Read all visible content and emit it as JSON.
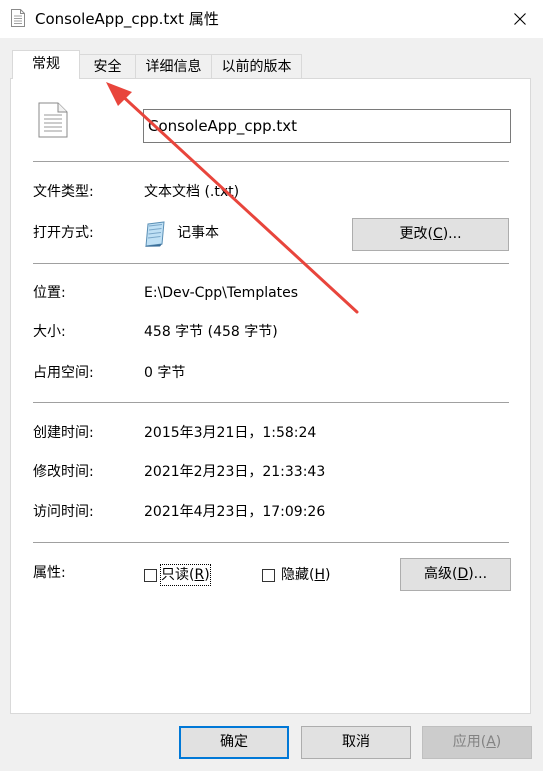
{
  "window": {
    "title": "ConsoleApp_cpp.txt 属性"
  },
  "tabs": [
    {
      "label": "常规",
      "active": true
    },
    {
      "label": "安全",
      "active": false
    },
    {
      "label": "详细信息",
      "active": false
    },
    {
      "label": "以前的版本",
      "active": false
    }
  ],
  "general": {
    "filename": "ConsoleApp_cpp.txt",
    "file_type_label": "文件类型:",
    "file_type_value": "文本文档 (.txt)",
    "open_with_label": "打开方式:",
    "open_with_value": "记事本",
    "change_button_prefix": "更改(",
    "change_button_key": "C",
    "change_button_suffix": ")...",
    "location_label": "位置:",
    "location_value": "E:\\Dev-Cpp\\Templates",
    "size_label": "大小:",
    "size_value": "458 字节 (458 字节)",
    "disk_size_label": "占用空间:",
    "disk_size_value": "0 字节",
    "created_label": "创建时间:",
    "created_value": "2015年3月21日，1:58:24",
    "modified_label": "修改时间:",
    "modified_value": "2021年2月23日，21:33:43",
    "accessed_label": "访问时间:",
    "accessed_value": "2021年4月23日，17:09:26",
    "attributes_label": "属性:",
    "readonly_prefix": "只读(",
    "readonly_key": "R",
    "readonly_suffix": ")",
    "readonly_checked": false,
    "hidden_prefix": "隐藏(",
    "hidden_key": "H",
    "hidden_suffix": ")",
    "hidden_checked": false,
    "advanced_prefix": "高级(",
    "advanced_key": "D",
    "advanced_suffix": ")..."
  },
  "footer": {
    "ok_label": "确定",
    "cancel_label": "取消",
    "apply_prefix": "应用(",
    "apply_key": "A",
    "apply_suffix": ")"
  },
  "annotation": {
    "arrow_color": "#e8453c"
  }
}
